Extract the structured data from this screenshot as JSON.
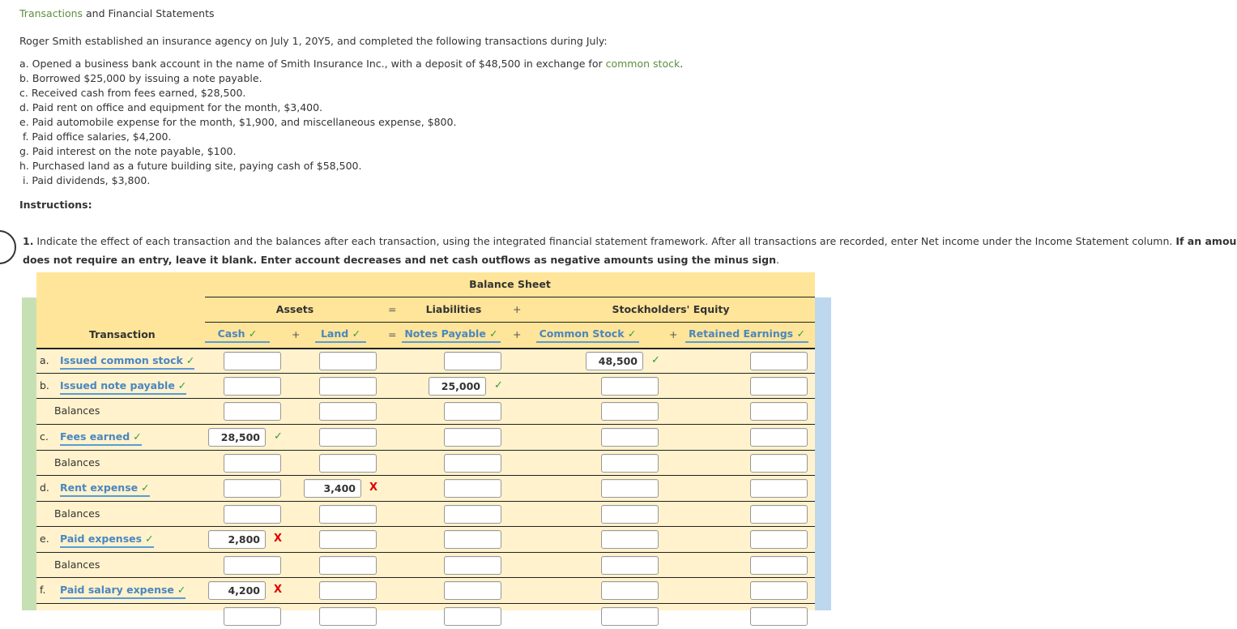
{
  "page": {
    "title_link": "Transactions",
    "title_rest": " and Financial Statements",
    "intro": "Roger Smith established an insurance agency on July 1, 20Y5, and completed the following transactions during July:",
    "transactions": [
      {
        "prefix": "a. Opened a business bank account in the name of Smith Insurance Inc., with a deposit of $48,500 in exchange for ",
        "link": "common stock",
        "suffix": "."
      },
      {
        "prefix": "b. Borrowed $25,000 by issuing a note payable."
      },
      {
        "prefix": "c. Received cash from fees earned, $28,500."
      },
      {
        "prefix": "d. Paid rent on office and equipment for the month, $3,400."
      },
      {
        "prefix": "e. Paid automobile expense for the month, $1,900, and miscellaneous expense, $800."
      },
      {
        "prefix": " f. Paid office salaries, $4,200."
      },
      {
        "prefix": "g. Paid interest on the note payable, $100."
      },
      {
        "prefix": "h. Purchased land as a future building site, paying cash of $58,500."
      },
      {
        "prefix": " i. Paid dividends, $3,800."
      }
    ],
    "instructions_heading": "Instructions:",
    "question": {
      "number": "1.",
      "text": " Indicate the effect of each transaction and the balances after each transaction, using the integrated financial statement framework. After all transactions are recorded, enter Net income under the Income Statement column. ",
      "bold_part1": "If an amount box",
      "bold_part2": "does not require an entry, leave it blank. Enter account decreases and net cash outflows as negative amounts using the minus sign",
      "end": "."
    }
  },
  "table": {
    "group_header": "Balance Sheet",
    "section_headers": {
      "assets": "Assets",
      "eq1": "=",
      "liabilities": "Liabilities",
      "plus1": "+",
      "equity": "Stockholders' Equity"
    },
    "transaction_header": "Transaction",
    "columns": [
      {
        "label": "Cash",
        "status": "✓"
      },
      {
        "label": "Land",
        "status": "✓"
      },
      {
        "label": "Notes Payable",
        "status": "✓"
      },
      {
        "label": "Common Stock",
        "status": "✓"
      },
      {
        "label": "Retained Earnings",
        "status": "✓"
      }
    ],
    "operators": {
      "plus": "+",
      "equals": "="
    },
    "rows": [
      {
        "letter": "a.",
        "label": "Issued common stock",
        "label_status": "✓",
        "type": "transaction",
        "cells": [
          {
            "value": ""
          },
          {
            "value": ""
          },
          {
            "value": ""
          },
          {
            "value": "48,500",
            "status": "✓"
          },
          {
            "value": ""
          }
        ]
      },
      {
        "letter": "b.",
        "label": "Issued note payable",
        "label_status": "✓",
        "type": "transaction",
        "cells": [
          {
            "value": ""
          },
          {
            "value": ""
          },
          {
            "value": "25,000",
            "status": "✓"
          },
          {
            "value": ""
          },
          {
            "value": ""
          }
        ]
      },
      {
        "label": "Balances",
        "type": "balance",
        "cells": [
          {
            "value": ""
          },
          {
            "value": ""
          },
          {
            "value": ""
          },
          {
            "value": ""
          },
          {
            "value": ""
          }
        ]
      },
      {
        "letter": "c.",
        "label": "Fees earned",
        "label_status": "✓",
        "type": "transaction",
        "cells": [
          {
            "value": "28,500",
            "status": "✓"
          },
          {
            "value": ""
          },
          {
            "value": ""
          },
          {
            "value": ""
          },
          {
            "value": ""
          }
        ]
      },
      {
        "label": "Balances",
        "type": "balance",
        "cells": [
          {
            "value": ""
          },
          {
            "value": ""
          },
          {
            "value": ""
          },
          {
            "value": ""
          },
          {
            "value": ""
          }
        ]
      },
      {
        "letter": "d.",
        "label": "Rent expense",
        "label_status": "✓",
        "type": "transaction",
        "cells": [
          {
            "value": ""
          },
          {
            "value": "3,400",
            "status": "X"
          },
          {
            "value": ""
          },
          {
            "value": ""
          },
          {
            "value": ""
          }
        ]
      },
      {
        "label": "Balances",
        "type": "balance",
        "cells": [
          {
            "value": ""
          },
          {
            "value": ""
          },
          {
            "value": ""
          },
          {
            "value": ""
          },
          {
            "value": ""
          }
        ]
      },
      {
        "letter": "e.",
        "label": "Paid expenses",
        "label_status": "✓",
        "type": "transaction",
        "cells": [
          {
            "value": "2,800",
            "status": "X"
          },
          {
            "value": ""
          },
          {
            "value": ""
          },
          {
            "value": ""
          },
          {
            "value": ""
          }
        ]
      },
      {
        "label": "Balances",
        "type": "balance",
        "cells": [
          {
            "value": ""
          },
          {
            "value": ""
          },
          {
            "value": ""
          },
          {
            "value": ""
          },
          {
            "value": ""
          }
        ]
      },
      {
        "letter": "f.",
        "label": "Paid salary expense",
        "label_status": "✓",
        "type": "transaction",
        "cells": [
          {
            "value": "4,200",
            "status": "X"
          },
          {
            "value": ""
          },
          {
            "value": ""
          },
          {
            "value": ""
          },
          {
            "value": ""
          }
        ]
      },
      {
        "label": "",
        "type": "partial",
        "cells": [
          {
            "value": ""
          },
          {
            "value": ""
          },
          {
            "value": ""
          },
          {
            "value": ""
          },
          {
            "value": ""
          }
        ]
      }
    ]
  },
  "colors": {
    "header_bg": "#ffe599",
    "row_bg": "#fff2cc",
    "left_bar": "#c6e0b4",
    "right_bar": "#bdd7ee",
    "link_blue": "#4a86c0",
    "correct_green": "#2e9e3a",
    "incorrect_red": "#e00000",
    "title_green": "#5b8f3d"
  }
}
